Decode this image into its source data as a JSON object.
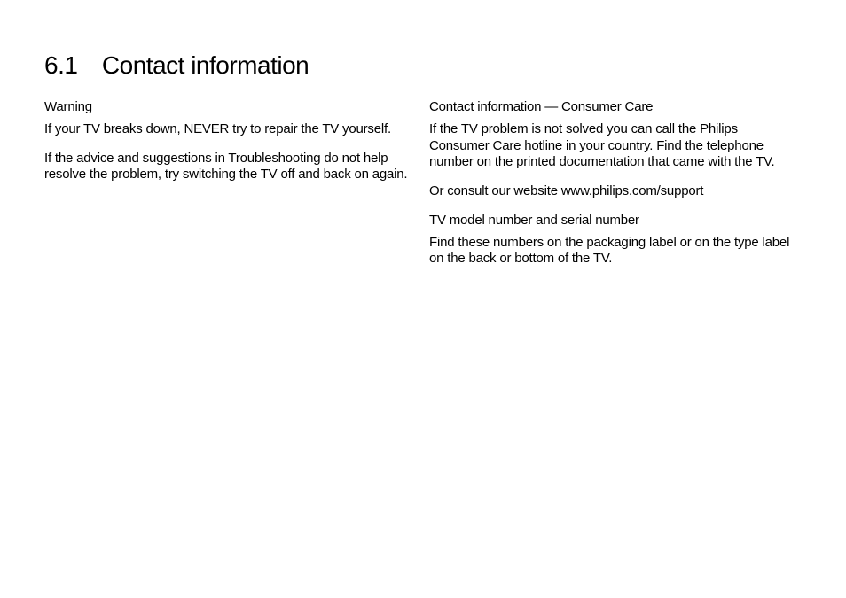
{
  "title": "6.1 Contact information",
  "left": {
    "heading1": "Warning",
    "p1": "If your TV breaks down, NEVER try to repair the TV yourself.",
    "p2": "If the advice and suggestions in Troubleshooting do not help resolve the problem, try switching the TV off and back on again."
  },
  "right": {
    "heading1": "Contact information — Consumer Care",
    "p1": "If the TV problem is not solved you can call the Philips Consumer Care hotline in your country. Find the telephone number on the printed documentation that came with the TV.",
    "p2": "Or consult our website www.philips.com/support",
    "heading2": "TV model number and serial number",
    "p3": "Find these numbers on the packaging label or on the type label on the back or bottom of the TV."
  }
}
